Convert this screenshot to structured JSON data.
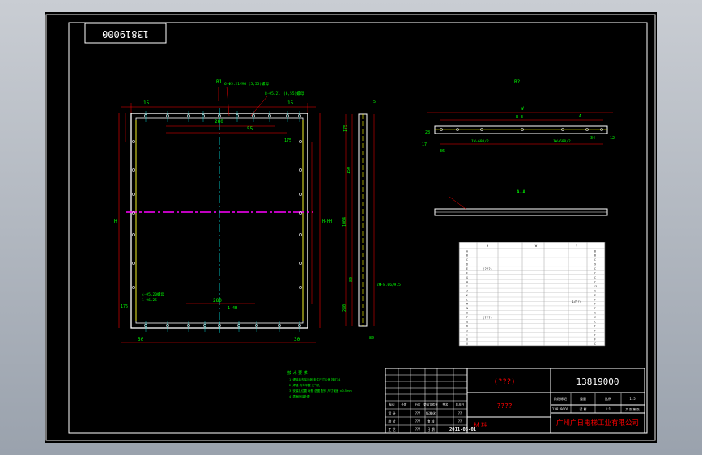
{
  "drawing": {
    "mirror_code": "13819000",
    "view_label_b": "B1",
    "view_label_right": "B?",
    "section_label": "A-A"
  },
  "front_view": {
    "dims_top": [
      "15",
      "280",
      "55",
      "15"
    ],
    "dims_bottom": [
      "50",
      "280",
      "1-4H",
      "30"
    ],
    "dim_left_h": "H",
    "dim_right_h": "H-HH",
    "dim_mid": "175",
    "dim_175b": "175",
    "note_top": "6-Φ5.21/M6 (5,55)螺母",
    "note_top2": "8-Φ5.21 Ⅰ(6,55)螺母",
    "note_bl": "4-Φ5.20螺母",
    "note_bl2": "1-Φ6.25"
  },
  "right_view": {
    "dims": [
      "5",
      "175",
      "80",
      "150",
      "1004",
      "80",
      "280"
    ],
    "note": "2Φ-8.06/9.5"
  },
  "top_view": {
    "dim_main": "W",
    "dim_inner": "W-3",
    "dim_left": "1W-680/2",
    "dim_right": "1W-680/2",
    "dim_small": [
      "36",
      "28",
      "17",
      "34",
      "12"
    ],
    "note": "A"
  },
  "notes": {
    "title": "技 术 要 求",
    "lines": [
      "1. 焊接后去除毛刺 未注尺寸公差 按IT14",
      "2. 焊缝 均匀平整 无气孔",
      "3. 安装孔位置 对照 总图 配作 尺寸误差 ±0.5mm",
      "4. 表面喷涂处理"
    ]
  },
  "table": {
    "col_headers": [
      "",
      "H",
      "W",
      "?"
    ],
    "rows": [
      [
        "A",
        "",
        "",
        "B"
      ],
      [
        "B",
        "",
        "",
        "B"
      ],
      [
        "C",
        "",
        "",
        "C"
      ],
      [
        "D",
        "",
        "",
        "9"
      ],
      [
        "E",
        "",
        "",
        "C"
      ],
      [
        "F",
        "",
        "",
        "C"
      ],
      [
        "G",
        "",
        "",
        "C"
      ],
      [
        "H",
        "",
        "",
        "C"
      ],
      [
        "I",
        "",
        "",
        "13"
      ],
      [
        "J",
        "",
        "",
        "C"
      ],
      [
        "K",
        "",
        "",
        "F"
      ],
      [
        "L",
        "",
        "",
        "F"
      ],
      [
        "M",
        "",
        "",
        "F"
      ],
      [
        "N",
        "",
        "",
        "F"
      ],
      [
        "O",
        "",
        "",
        "C"
      ],
      [
        "P",
        "",
        "",
        "C"
      ],
      [
        "Q",
        "",
        "",
        "C"
      ],
      [
        "R",
        "",
        "",
        "F"
      ],
      [
        "S",
        "",
        "",
        "F"
      ],
      [
        "T",
        "",
        "",
        "F"
      ],
      [
        "U",
        "",
        "",
        "F"
      ],
      [
        "V",
        "",
        "",
        "C"
      ]
    ],
    "group_labels": [
      "(???)",
      "(???)",
      "13???"
    ]
  },
  "title_block": {
    "part_name": "(???)",
    "drawing_no": "13819000",
    "sub_name": "????",
    "material_label": "材 料",
    "date": "2011-03-01",
    "company": "广州广日电梯工业有限公司",
    "rev_headers": [
      "标记",
      "处数",
      "分区",
      "更改文件号",
      "签名",
      "年月日"
    ],
    "rows": [
      {
        "label": "设 计",
        "val": "???",
        "label2": "标准化",
        "val2": "??"
      },
      {
        "label": "校 对",
        "val": "???",
        "label2": "审 核",
        "val2": "??"
      },
      {
        "label": "工 艺",
        "val": "???",
        "label2": "日 期",
        "val2": ""
      }
    ],
    "stage_headers": [
      "阶段标记",
      "重量",
      "比例"
    ],
    "scale": "1:5",
    "sheet_label": "共 张 第 张",
    "sheet_values": [
      "13819000",
      "试 样",
      "1:1"
    ]
  }
}
